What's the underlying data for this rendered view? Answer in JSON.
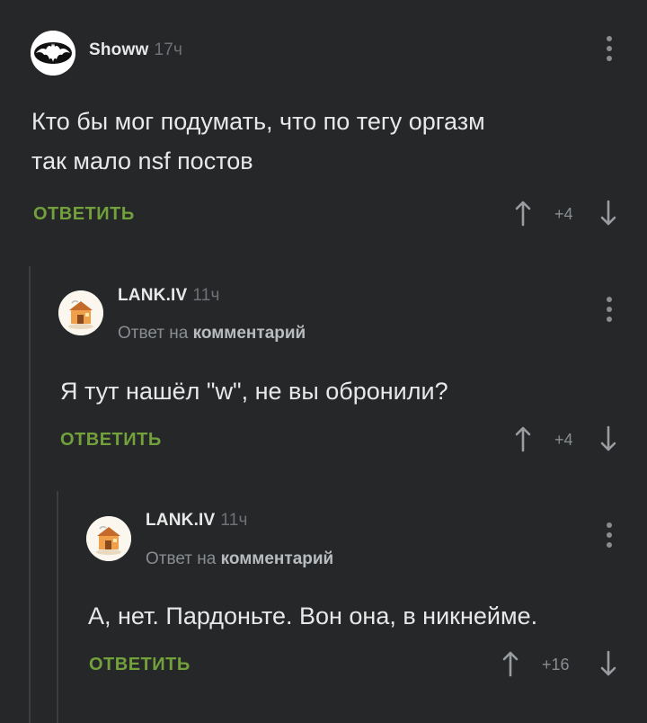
{
  "comments": [
    {
      "author": "Showw",
      "time": "17ч",
      "body_line1": "Кто бы мог подумать, что по тегу оргазм",
      "body_line2": "так мало nsf постов",
      "reply_label": "ОТВЕТИТЬ",
      "rating": "+4",
      "avatar": "bat-logo-icon"
    },
    {
      "author": "LANK.IV",
      "time": "11ч",
      "reply_prefix": "Ответ на",
      "reply_link": "комментарий",
      "body": "Я тут нашёл \"w\", не вы обронили?",
      "reply_label": "ОТВЕТИТЬ",
      "rating": "+4",
      "avatar": "cartoon-house-icon"
    },
    {
      "author": "LANK.IV",
      "time": "11ч",
      "reply_prefix": "Ответ на",
      "reply_link": "комментарий",
      "body": "А, нет. Пардоньте. Вон она, в никнейме.",
      "reply_label": "ОТВЕТИТЬ",
      "rating": "+16",
      "avatar": "cartoon-house-icon"
    }
  ],
  "colors": {
    "background": "#252729",
    "accent_green": "#72a13b",
    "muted": "#8a8d90",
    "thread_line": "#3b3e41"
  }
}
